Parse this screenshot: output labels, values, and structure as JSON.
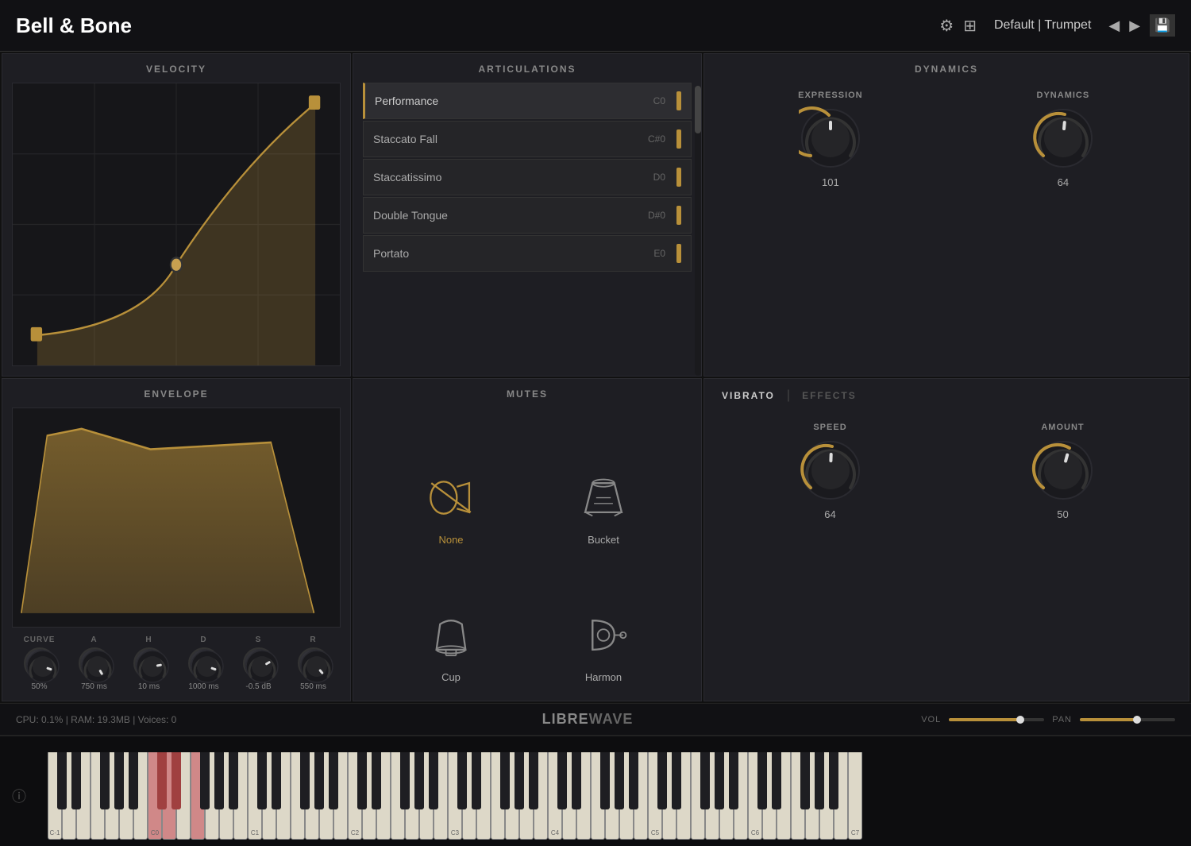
{
  "app": {
    "title": "Bell & Bone",
    "preset": "Default | Trumpet",
    "cpu": "CPU: 0.1%",
    "ram": "RAM: 19.3MB",
    "voices": "Voices: 0",
    "brand": "LIBRE",
    "brand2": "WAVE"
  },
  "header": {
    "settings_icon": "⚙",
    "grid_icon": "⊞",
    "prev_icon": "◀",
    "next_icon": "▶",
    "save_icon": "💾"
  },
  "velocity": {
    "title": "VELOCITY"
  },
  "articulations": {
    "title": "ARTICULATIONS",
    "items": [
      {
        "name": "Performance",
        "key": "C0",
        "active": true
      },
      {
        "name": "Staccato Fall",
        "key": "C#0",
        "active": false
      },
      {
        "name": "Staccatissimo",
        "key": "D0",
        "active": false
      },
      {
        "name": "Double Tongue",
        "key": "D#0",
        "active": false
      },
      {
        "name": "Portato",
        "key": "E0",
        "active": false
      }
    ]
  },
  "dynamics": {
    "title": "DYNAMICS",
    "expression": {
      "label": "EXPRESSION",
      "value": "101",
      "rotation": 180
    },
    "dynamics": {
      "label": "DYNAMICS",
      "value": "64",
      "rotation": 200
    }
  },
  "envelope": {
    "title": "ENVELOPE",
    "controls": [
      {
        "label": "CURVE",
        "value": "50%",
        "rotation": 200
      },
      {
        "label": "A",
        "value": "750 ms",
        "rotation": 220
      },
      {
        "label": "H",
        "value": "10 ms",
        "rotation": 185
      },
      {
        "label": "D",
        "value": "1000 ms",
        "rotation": 200
      },
      {
        "label": "S",
        "value": "-0.5 dB",
        "rotation": 175
      },
      {
        "label": "R",
        "value": "550 ms",
        "rotation": 215
      }
    ]
  },
  "mutes": {
    "title": "MUTES",
    "items": [
      {
        "name": "None",
        "active": true
      },
      {
        "name": "Bucket",
        "active": false
      },
      {
        "name": "Cup",
        "active": false
      },
      {
        "name": "Harmon",
        "active": false
      }
    ]
  },
  "vibrato": {
    "title": "VIBRATO",
    "effects_label": "EFFECTS",
    "speed": {
      "label": "SPEED",
      "value": "64",
      "rotation": 200
    },
    "amount": {
      "label": "AMOUNT",
      "value": "50",
      "rotation": 215
    }
  },
  "vol_pan": {
    "vol_label": "VOL",
    "pan_label": "PAN",
    "vol_pct": 75,
    "pan_pct": 60
  },
  "piano": {
    "octaves": [
      "C-1",
      "C0",
      "C1",
      "C2",
      "C3",
      "C4",
      "C5",
      "C6",
      "C7"
    ],
    "active_whites": [
      14,
      15,
      17,
      18,
      19
    ],
    "active_blacks": [
      14,
      15,
      17
    ]
  }
}
